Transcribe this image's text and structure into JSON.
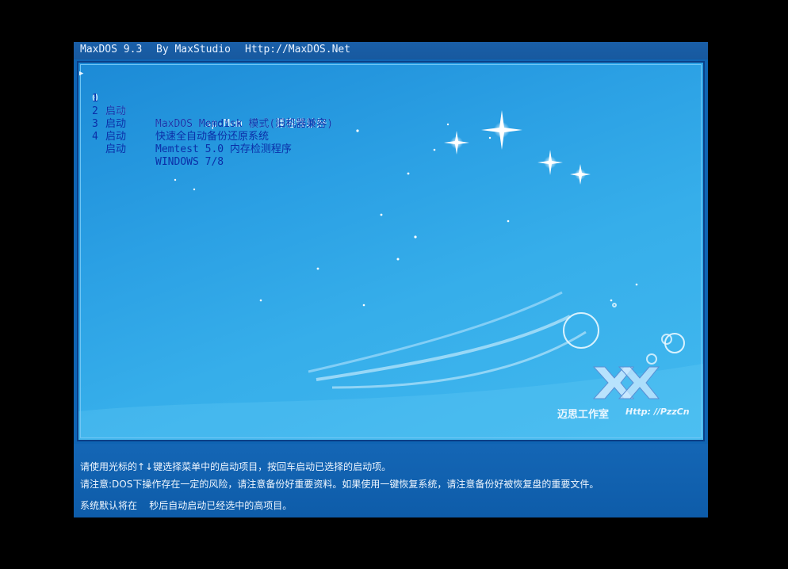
{
  "header": {
    "version": "MaxDOS 9.3",
    "author": "By MaxStudio",
    "url": "Http://MaxDOS.Net"
  },
  "menu": {
    "selected_index": 0,
    "items": [
      {
        "num": "0",
        "action": "启动",
        "title": "MaxDOS Map-Mem 模式(兼容性较好)"
      },
      {
        "num": "1",
        "action": "启动",
        "title": "MaxDOS Memdisk 模式(旧机器兼容)"
      },
      {
        "num": "2",
        "action": "启动",
        "title": "快速全自动备份还原系统"
      },
      {
        "num": "3",
        "action": "启动",
        "title": "Memtest 5.0 内存检测程序"
      },
      {
        "num": "4",
        "action": "启动",
        "title": "WINDOWS 7/8"
      }
    ]
  },
  "logo": {
    "name": "迈思工作室",
    "url": "Http: //PzzCn",
    "icon": "maxstudio-logo-icon"
  },
  "footer": {
    "line1": "请使用光标的↑↓键选择菜单中的启动项目，按回车启动已选择的启动项。",
    "line2": "请注意:DOS下操作存在一定的风险，请注意备份好重要资料。如果使用一键恢复系统，请注意备份好被恢复盘的重要文件。",
    "line3": "系统默认将在    秒后自动启动已经选中的高项目。"
  },
  "colors": {
    "background": "#000000",
    "screen": "#0f64b3",
    "menu_text": "#0b2fa8",
    "selected_text": "#eaf5ff"
  }
}
